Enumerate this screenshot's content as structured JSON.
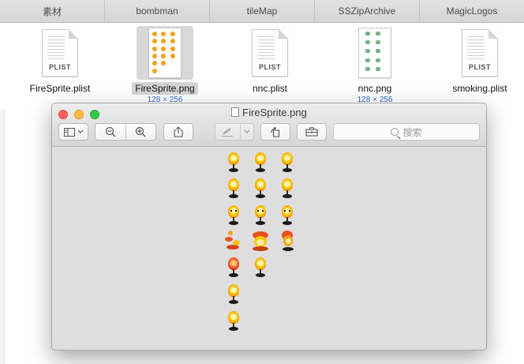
{
  "finder": {
    "tabs": [
      "素材",
      "bombman",
      "tileMap",
      "SSZipArchive",
      "MagicLogos"
    ],
    "files": [
      {
        "name": "FireSprite.plist",
        "ext": "PLIST",
        "dims": "",
        "selected": false
      },
      {
        "name": "FireSprite.png",
        "ext": "",
        "dims": "128 × 256",
        "selected": true
      },
      {
        "name": "nnc.plist",
        "ext": "PLIST",
        "dims": "",
        "selected": false
      },
      {
        "name": "nnc.png",
        "ext": "",
        "dims": "128 × 256",
        "selected": false
      },
      {
        "name": "smoking.plist",
        "ext": "PLIST",
        "dims": "",
        "selected": false
      }
    ]
  },
  "preview": {
    "title": "FireSprite.png",
    "search_placeholder": "搜索",
    "toolbar_icons": [
      "sidebar-icon",
      "chevron-down-icon",
      "zoom-out-icon",
      "zoom-in-icon",
      "share-icon",
      "pen-icon",
      "chevron-down-icon",
      "rotate-icon",
      "toolbox-icon",
      "search-icon"
    ],
    "sprites_layout": "3 columns x 7 rows of fire sprites; rows 1-3 flames with faces, row 4 burst, rows 5-7 single flames"
  },
  "colors": {
    "close": "#fc605c",
    "minimize": "#fdbc40",
    "maximize": "#34c84a",
    "dims_text": "#2f6fd0",
    "flame": "#ffc600"
  }
}
